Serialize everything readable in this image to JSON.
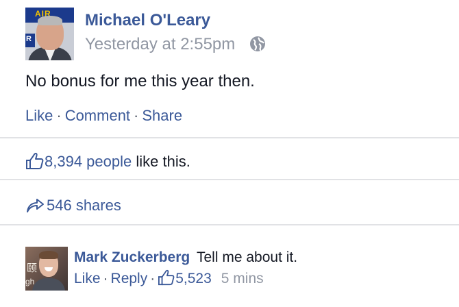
{
  "post": {
    "author": "Michael O'Leary",
    "timestamp": "Yesterday at 2:55pm",
    "avatar_banner_text": "RYANAIR",
    "text": "No bonus for me this year then.",
    "actions": {
      "like": "Like",
      "comment": "Comment",
      "share": "Share",
      "separator": "·"
    },
    "likes": {
      "count_text": "8,394 people",
      "suffix": "like this.",
      "icon": "thumbs-up-icon"
    },
    "shares": {
      "text": "546 shares",
      "icon": "share-arrow-icon"
    },
    "privacy_icon": "globe-icon"
  },
  "comment": {
    "author": "Mark Zuckerberg",
    "text": "Tell me about it.",
    "like_label": "Like",
    "reply_label": "Reply",
    "separator": "·",
    "like_count": "5,523",
    "time": "5 mins"
  },
  "colors": {
    "link": "#3b5998",
    "text": "#141823",
    "muted": "#9197a3",
    "divider": "#e1e2e5"
  }
}
